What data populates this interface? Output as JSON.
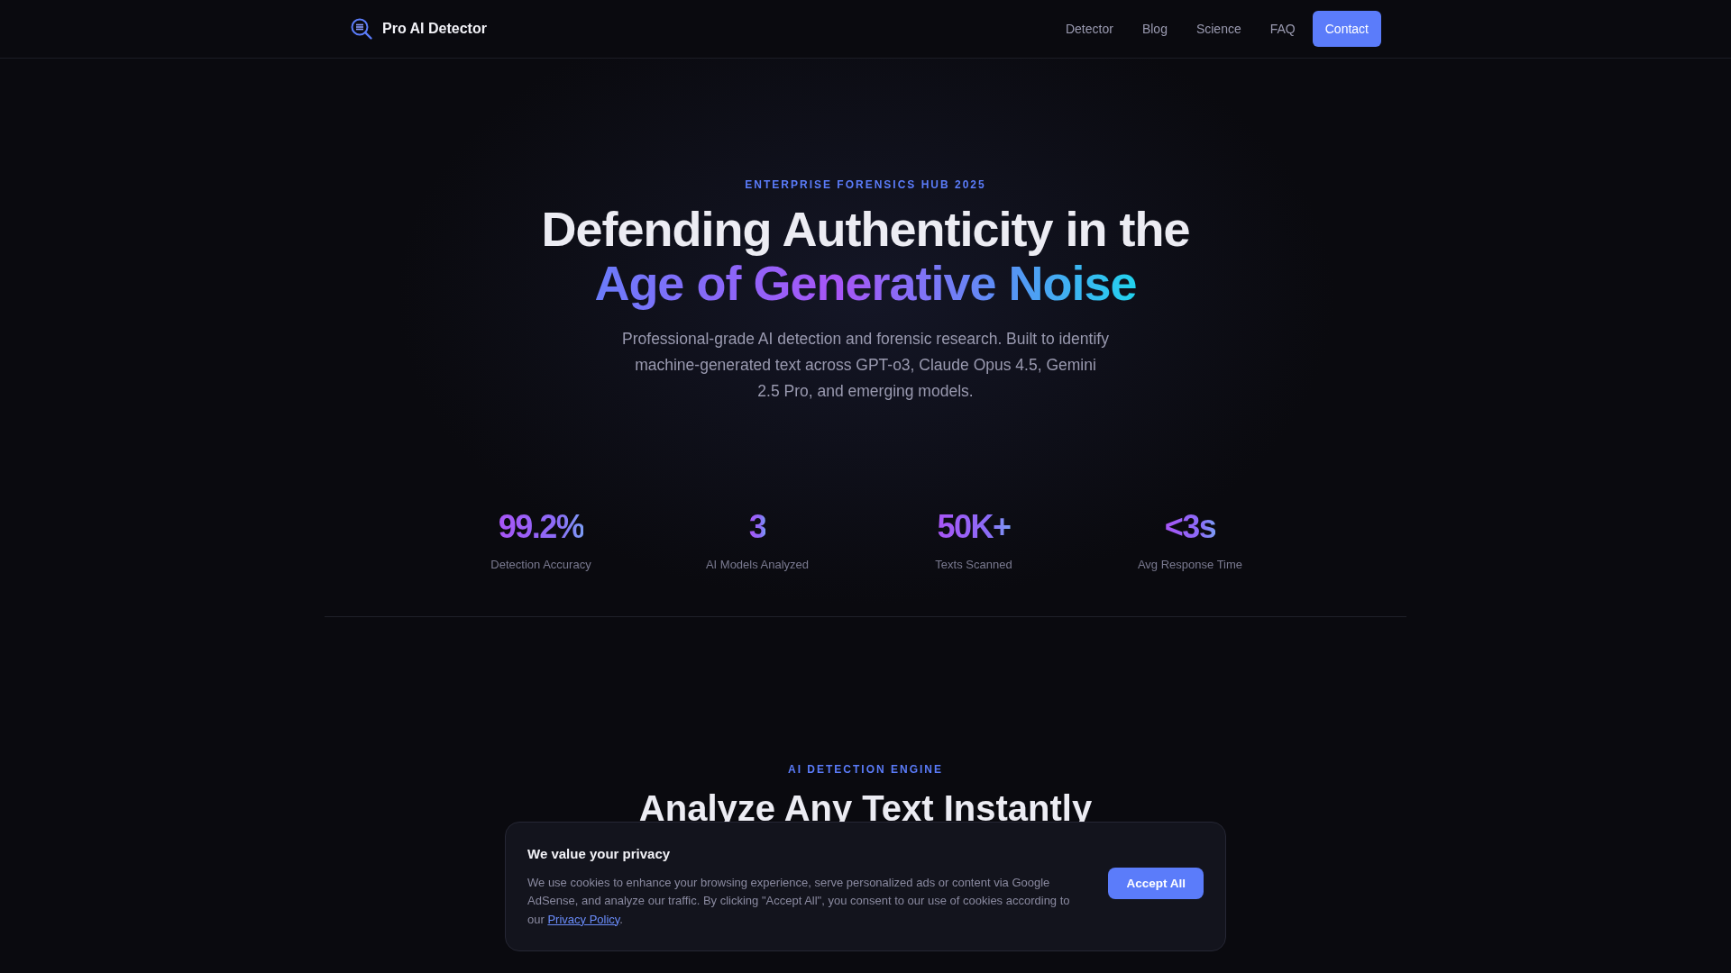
{
  "header": {
    "brand": "Pro AI Detector",
    "nav": [
      {
        "label": "Detector",
        "kind": "link"
      },
      {
        "label": "Blog",
        "kind": "link"
      },
      {
        "label": "Science",
        "kind": "link"
      },
      {
        "label": "FAQ",
        "kind": "link"
      },
      {
        "label": "Contact",
        "kind": "button"
      }
    ]
  },
  "hero": {
    "eyebrow": "ENTERPRISE FORENSICS HUB 2025",
    "title_line_1": "Defending Authenticity in the",
    "title_line_2": "Age of Generative Noise",
    "description": "Professional-grade AI detection and forensic research. Built to identify machine-generated text across GPT-o3, Claude Opus 4.5, Gemini 2.5 Pro, and emerging models."
  },
  "stats": [
    {
      "value": "99.2%",
      "label": "Detection Accuracy"
    },
    {
      "value": "3",
      "label": "AI Models Analyzed"
    },
    {
      "value": "50K+",
      "label": "Texts Scanned"
    },
    {
      "value": "<3s",
      "label": "Avg Response Time"
    }
  ],
  "detector_section": {
    "eyebrow": "AI DETECTION ENGINE",
    "title": "Analyze Any Text Instantly"
  },
  "cookie_banner": {
    "title": "We value your privacy",
    "text_before_link": "We use cookies to enhance your browsing experience, serve personalized ads or content via Google AdSense, and analyze our traffic. By clicking \"Accept All\", you consent to our use of cookies according to our",
    "link": "Privacy Policy",
    "text_after_link": ".",
    "button": "Accept All"
  }
}
